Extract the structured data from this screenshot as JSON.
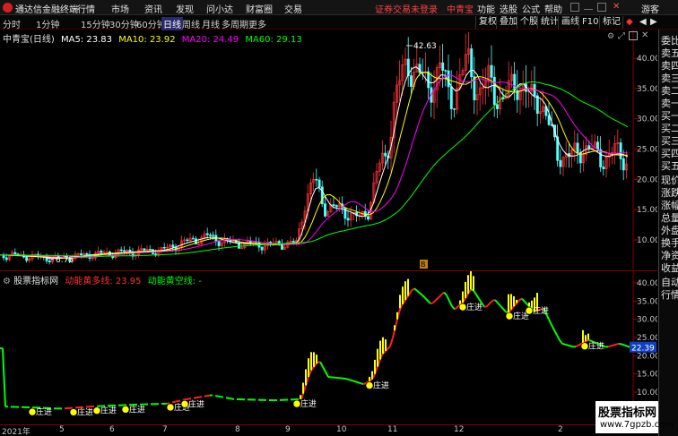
{
  "app": {
    "title": "通达信金融终端",
    "menu": [
      "行情",
      "市场",
      "资讯",
      "发现",
      "问小达",
      "财富圈",
      "交易"
    ],
    "notice": "证券交易未登录",
    "stock_name_top": "中青宝",
    "right_menu": [
      "功能",
      "选股",
      "公式",
      "帮助"
    ],
    "user": "游客"
  },
  "periods": [
    "分时",
    "1分钟",
    "15分钟",
    "30分钟",
    "60分钟",
    "日线",
    "周线",
    "月线",
    "多周期",
    "更多"
  ],
  "active_period": "日线",
  "right_tabs": [
    "复权",
    "叠加",
    "个股",
    "统计",
    "画线",
    "F10",
    "标记",
    "◆"
  ],
  "main": {
    "stock_label": "中青宝(日线)",
    "ma5": "MA5: 23.83",
    "ma10": "MA10: 23.92",
    "ma20": "MA20: 24.49",
    "ma60": "MA60: 29.13",
    "y_ticks": [
      "40.00",
      "35.00",
      "30.00",
      "25.00",
      "20.00",
      "15.00",
      "10.00"
    ],
    "high_label": "42.63",
    "low_label": "6.75",
    "marker": "B"
  },
  "indicator": {
    "name": "股票指标网",
    "line1": "动能黄多线: 23.95",
    "line2": "动能黄空线: -",
    "y_ticks": [
      "40.00",
      "35.00",
      "30.00",
      "25.00",
      "20.00",
      "15.00",
      "10.00"
    ],
    "current_value": "22.39",
    "signal": "庄进"
  },
  "x_axis": [
    "2021年",
    "5",
    "6",
    "7",
    "8",
    "9",
    "10",
    "11",
    "12",
    "2"
  ],
  "sidebar": [
    "委比",
    "卖五",
    "卖四",
    "卖三",
    "卖二",
    "卖一",
    "买一",
    "买二",
    "买三",
    "买四",
    "买五",
    "现价",
    "涨跌",
    "涨幅",
    "总量",
    "外盘",
    "换手",
    "净资",
    "收益",
    "自动",
    "行情"
  ],
  "watermark": {
    "line1": "股票指标网",
    "line2": "www.7gpzb.com"
  },
  "colors": {
    "up": "#ff3232",
    "down": "#54ffff",
    "ma5": "#ffffff",
    "ma10": "#ffff00",
    "ma20": "#ff00ff",
    "ma60": "#00ff00",
    "yellow": "#ffff00",
    "red": "#ff2020",
    "green": "#00ff00"
  },
  "chart_data": {
    "type": "line",
    "title": "中青宝(日线)",
    "xlabel": "",
    "ylabel": "",
    "ylim": [
      6,
      43
    ],
    "categories": [
      "2021年",
      "5",
      "6",
      "7",
      "8",
      "9",
      "10",
      "11",
      "12",
      "2"
    ],
    "series": [
      {
        "name": "MA5",
        "values": [
          7.5,
          7.8,
          8.6,
          10.6,
          9.3,
          15.8,
          14.0,
          36.0,
          37.5,
          23.8
        ]
      },
      {
        "name": "MA10",
        "values": [
          7.5,
          7.8,
          8.5,
          10.2,
          9.4,
          14.5,
          14.8,
          34.0,
          36.5,
          23.9
        ]
      },
      {
        "name": "MA20",
        "values": [
          7.6,
          7.8,
          8.4,
          9.8,
          9.5,
          12.5,
          15.0,
          31.0,
          35.5,
          24.5
        ]
      },
      {
        "name": "MA60",
        "values": [
          7.6,
          7.8,
          8.2,
          9.0,
          9.3,
          10.5,
          13.5,
          24.0,
          31.5,
          29.1
        ]
      }
    ],
    "high": 42.63,
    "low": 6.75
  }
}
